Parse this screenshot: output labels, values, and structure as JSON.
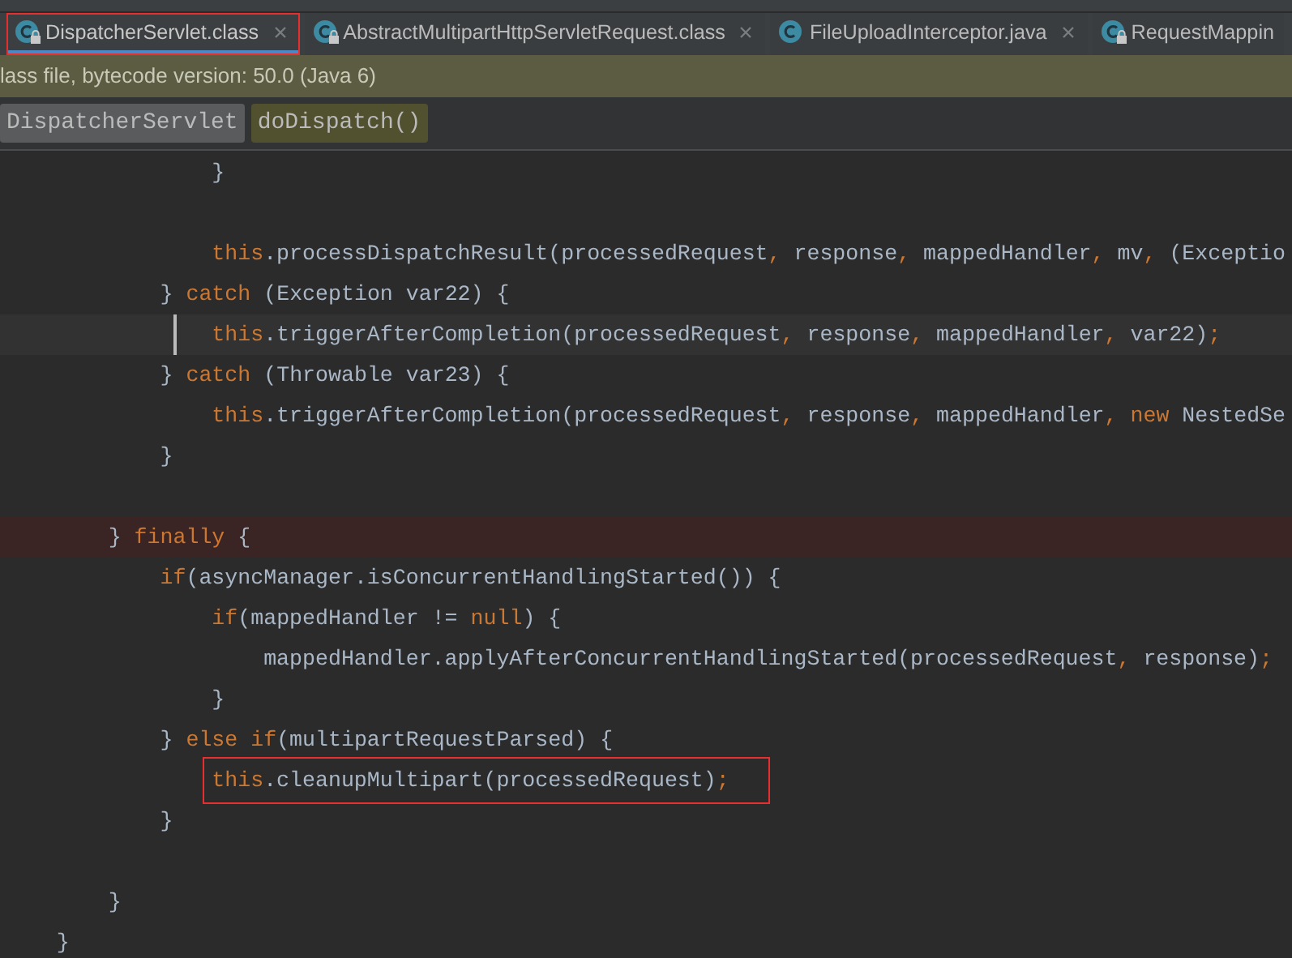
{
  "tabs": [
    {
      "label": "DispatcherServlet.class",
      "selected": true,
      "locked": true,
      "closable": true,
      "marked": true
    },
    {
      "label": "AbstractMultipartHttpServletRequest.class",
      "selected": false,
      "locked": true,
      "closable": true,
      "marked": false
    },
    {
      "label": "FileUploadInterceptor.java",
      "selected": false,
      "locked": false,
      "closable": true,
      "marked": false
    },
    {
      "label": "RequestMappin",
      "selected": false,
      "locked": true,
      "closable": false,
      "marked": false
    }
  ],
  "info_bar": {
    "text": "lass file, bytecode version: 50.0 (Java 6)"
  },
  "breadcrumbs": [
    {
      "label": "DispatcherServlet",
      "kind": "class"
    },
    {
      "label": "doDispatch()",
      "kind": "method"
    }
  ],
  "code": [
    {
      "children": [
        {
          "children": [
            {
              "children": [
                {
                  "children": [
                    {
                      "kind": "normal",
                      "boxed": false,
                      "tokens": [
                        {
                          "kind": "plain",
                          "text": "}"
                        }
                      ]
                    },
                    {
                      "kind": "normal",
                      "boxed": false
                    },
                    {
                      "kind": "normal",
                      "boxed": false,
                      "tokens": [
                        {
                          "kind": "keyword",
                          "text": "this"
                        },
                        {
                          "kind": "plain",
                          "text": ".processDispatchResult(processedRequest"
                        },
                        {
                          "kind": "keyword",
                          "text": ","
                        },
                        {
                          "kind": "plain",
                          "text": " response"
                        },
                        {
                          "kind": "keyword",
                          "text": ","
                        },
                        {
                          "kind": "plain",
                          "text": " mappedHandler"
                        },
                        {
                          "kind": "keyword",
                          "text": ","
                        },
                        {
                          "kind": "plain",
                          "text": " mv"
                        },
                        {
                          "kind": "keyword",
                          "text": ","
                        },
                        {
                          "kind": "plain",
                          "text": " (Exceptio"
                        }
                      ]
                    }
                  ]
                },
                {
                  "kind": "normal",
                  "boxed": false,
                  "tokens": [
                    {
                      "kind": "plain",
                      "text": "} "
                    },
                    {
                      "kind": "keyword",
                      "text": "catch"
                    },
                    {
                      "kind": "plain",
                      "text": " (Exception var22) {"
                    }
                  ]
                },
                {
                  "children": [
                    {
                      "kind": "current",
                      "boxed": false,
                      "tokens": [
                        {
                          "kind": "keyword",
                          "text": "this"
                        },
                        {
                          "kind": "plain",
                          "text": ".triggerAfterCompletion(processedRequest"
                        },
                        {
                          "kind": "keyword",
                          "text": ","
                        },
                        {
                          "kind": "plain",
                          "text": " response"
                        },
                        {
                          "kind": "keyword",
                          "text": ","
                        },
                        {
                          "kind": "plain",
                          "text": " mappedHandler"
                        },
                        {
                          "kind": "keyword",
                          "text": ","
                        },
                        {
                          "kind": "plain",
                          "text": " var22)"
                        },
                        {
                          "kind": "keyword",
                          "text": ";"
                        }
                      ]
                    }
                  ]
                },
                {
                  "kind": "normal",
                  "boxed": false,
                  "tokens": [
                    {
                      "kind": "plain",
                      "text": "} "
                    },
                    {
                      "kind": "keyword",
                      "text": "catch"
                    },
                    {
                      "kind": "plain",
                      "text": " (Throwable var23) {"
                    }
                  ]
                },
                {
                  "children": [
                    {
                      "kind": "normal",
                      "boxed": false,
                      "tokens": [
                        {
                          "kind": "keyword",
                          "text": "this"
                        },
                        {
                          "kind": "plain",
                          "text": ".triggerAfterCompletion(processedRequest"
                        },
                        {
                          "kind": "keyword",
                          "text": ","
                        },
                        {
                          "kind": "plain",
                          "text": " response"
                        },
                        {
                          "kind": "keyword",
                          "text": ","
                        },
                        {
                          "kind": "plain",
                          "text": " mappedHandler"
                        },
                        {
                          "kind": "keyword",
                          "text": ", new"
                        },
                        {
                          "kind": "plain",
                          "text": " NestedSe"
                        }
                      ]
                    }
                  ]
                },
                {
                  "kind": "normal",
                  "boxed": false,
                  "tokens": [
                    {
                      "kind": "plain",
                      "text": "}"
                    }
                  ]
                },
                {
                  "kind": "normal",
                  "boxed": false
                }
              ]
            },
            {
              "kind": "breakpoint",
              "boxed": false,
              "tokens": [
                {
                  "kind": "plain",
                  "text": "} "
                },
                {
                  "kind": "keyword",
                  "text": "finally"
                },
                {
                  "kind": "plain",
                  "text": " {"
                }
              ]
            },
            {
              "children": [
                {
                  "kind": "normal",
                  "boxed": false,
                  "tokens": [
                    {
                      "kind": "keyword",
                      "text": "if"
                    },
                    {
                      "kind": "plain",
                      "text": "(asyncManager.isConcurrentHandlingStarted()) {"
                    }
                  ]
                },
                {
                  "children": [
                    {
                      "kind": "normal",
                      "boxed": false,
                      "tokens": [
                        {
                          "kind": "keyword",
                          "text": "if"
                        },
                        {
                          "kind": "plain",
                          "text": "(mappedHandler != "
                        },
                        {
                          "kind": "keyword",
                          "text": "null"
                        },
                        {
                          "kind": "plain",
                          "text": ") {"
                        }
                      ]
                    },
                    {
                      "children": [
                        {
                          "kind": "normal",
                          "boxed": false,
                          "tokens": [
                            {
                              "kind": "plain",
                              "text": "mappedHandler.applyAfterConcurrentHandlingStarted(processedRequest"
                            },
                            {
                              "kind": "keyword",
                              "text": ","
                            },
                            {
                              "kind": "plain",
                              "text": " response)"
                            },
                            {
                              "kind": "keyword",
                              "text": ";"
                            }
                          ]
                        }
                      ]
                    },
                    {
                      "kind": "normal",
                      "boxed": false,
                      "tokens": [
                        {
                          "kind": "plain",
                          "text": "}"
                        }
                      ]
                    }
                  ]
                },
                {
                  "kind": "normal",
                  "boxed": false,
                  "tokens": [
                    {
                      "kind": "plain",
                      "text": "} "
                    },
                    {
                      "kind": "keyword",
                      "text": "else if"
                    },
                    {
                      "kind": "plain",
                      "text": "(multipartRequestParsed) {"
                    }
                  ]
                },
                {
                  "children": [
                    {
                      "kind": "normal",
                      "boxed": true,
                      "tokens": [
                        {
                          "kind": "keyword",
                          "text": "this"
                        },
                        {
                          "kind": "plain",
                          "text": ".cleanupMultipart(processedRequest)"
                        },
                        {
                          "kind": "keyword",
                          "text": ";"
                        }
                      ]
                    }
                  ]
                },
                {
                  "kind": "normal",
                  "boxed": false,
                  "tokens": [
                    {
                      "kind": "plain",
                      "text": "}"
                    }
                  ]
                }
              ]
            },
            {
              "kind": "normal",
              "boxed": false
            },
            {
              "kind": "normal",
              "boxed": false,
              "tokens": [
                {
                  "kind": "plain",
                  "text": "}"
                }
              ]
            }
          ]
        },
        {
          "kind": "normal",
          "boxed": false,
          "tokens": [
            {
              "kind": "plain",
              "text": "}"
            }
          ]
        }
      ]
    }
  ]
}
